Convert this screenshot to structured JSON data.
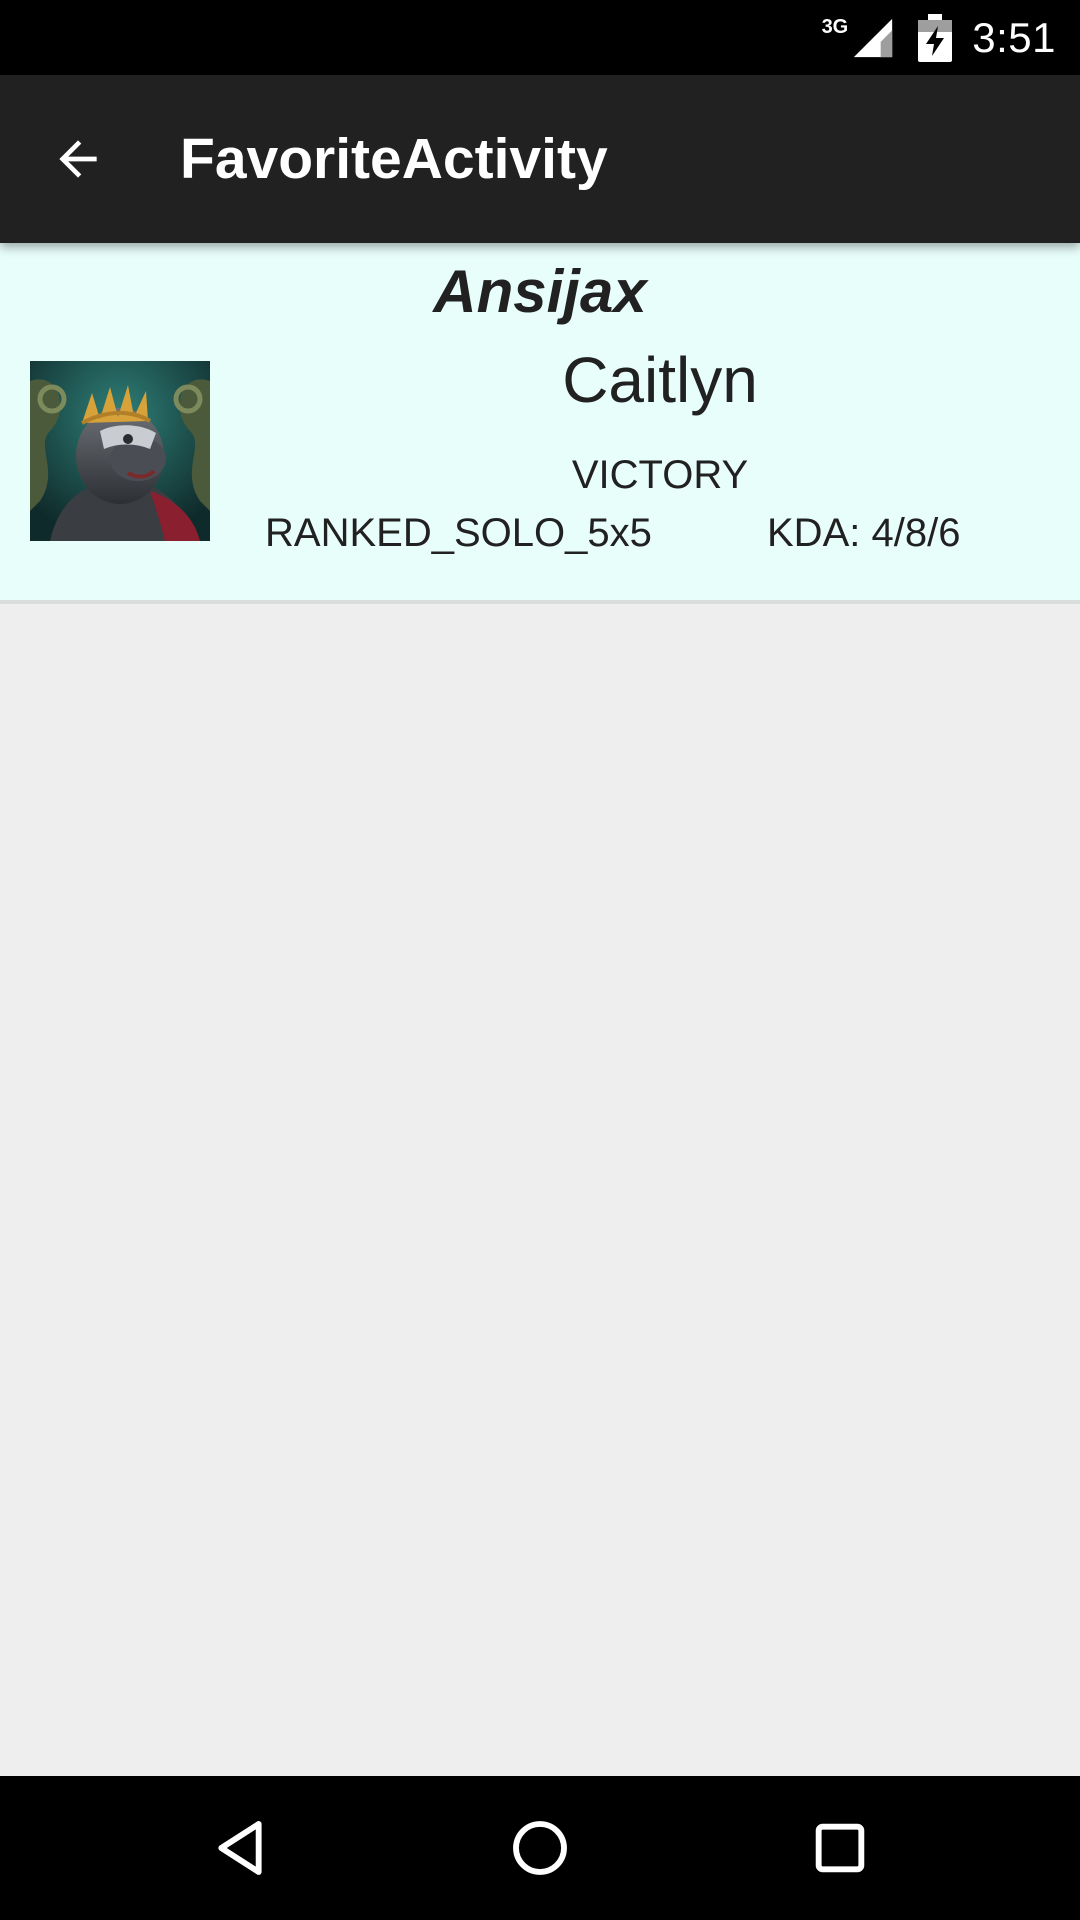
{
  "status_bar": {
    "network_type": "3G",
    "time": "3:51",
    "icons": [
      "signal-icon",
      "battery-charging-icon"
    ]
  },
  "app_bar": {
    "title": "FavoriteActivity",
    "back_icon": "arrow-back-icon"
  },
  "favorite_match": {
    "summoner_name": "Ansijax",
    "champion_name": "Caitlyn",
    "result": "VICTORY",
    "queue_type": "RANKED_SOLO_5x5",
    "kda": "KDA: 4/8/6",
    "avatar_icon": "champion-portrait-icon"
  },
  "nav_bar": {
    "icons": [
      "back-triangle-icon",
      "home-circle-icon",
      "recents-square-icon"
    ]
  },
  "colors": {
    "status_bar": "#000000",
    "app_bar": "#212121",
    "card_background": "#e8fefb",
    "page_background": "#eeeeee",
    "text": "#212121"
  }
}
